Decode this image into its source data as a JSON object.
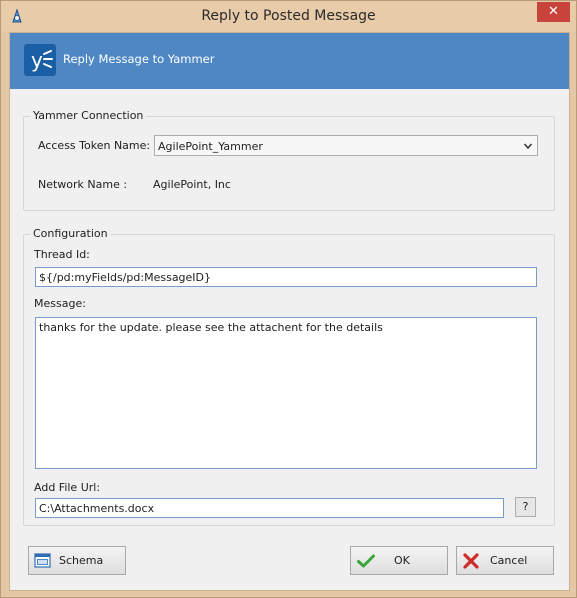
{
  "window": {
    "title": "Reply to Posted Message",
    "close_glyph": "✕"
  },
  "banner": {
    "title": "Reply Message to Yammer",
    "logo_glyph": "y"
  },
  "yammer_connection": {
    "group_title": "Yammer Connection",
    "access_token_label": "Access Token Name:",
    "access_token_value": "AgilePoint_Yammer",
    "network_name_label": "Network Name :",
    "network_name_value": "AgilePoint, Inc"
  },
  "configuration": {
    "group_title": "Configuration",
    "thread_id_label": "Thread Id:",
    "thread_id_value": "${/pd:myFields/pd:MessageID}",
    "message_label": "Message:",
    "message_value": "thanks for the update. please see the attachent for the details",
    "file_url_label": "Add File Url:",
    "file_url_value": "C:\\Attachments.docx",
    "help_button_label": "?"
  },
  "footer": {
    "schema_label": "Schema",
    "ok_label": "OK",
    "cancel_label": "Cancel"
  },
  "colors": {
    "banner": "#4e87c4",
    "close": "#c7433b",
    "frame": "#e8cba9"
  }
}
